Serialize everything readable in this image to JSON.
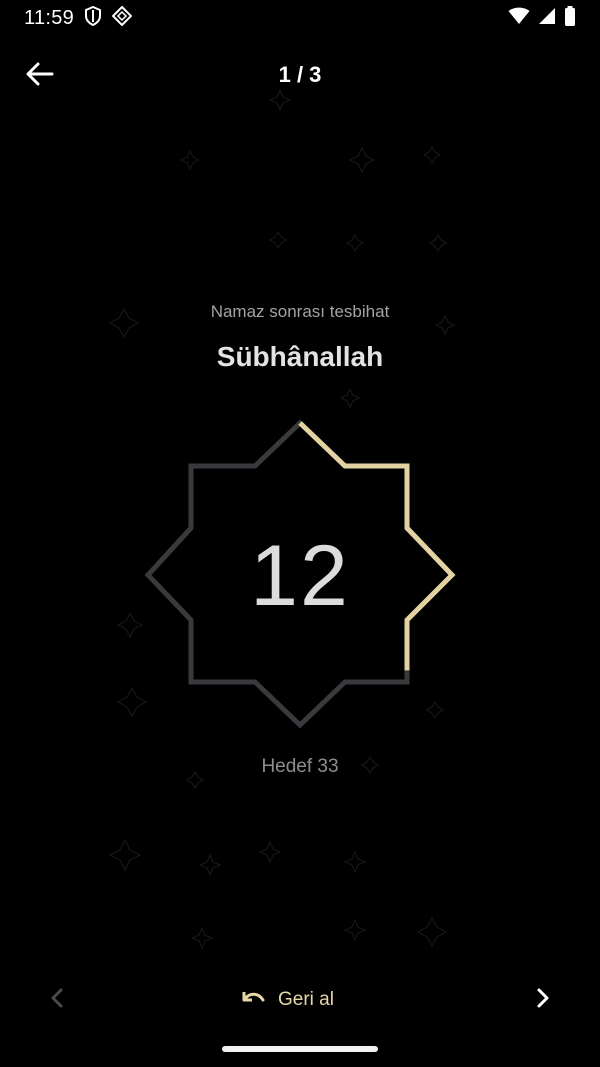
{
  "status_bar": {
    "time": "11:59",
    "left_icons": [
      "shield-icon",
      "app-notification-icon"
    ],
    "right_icons": [
      "wifi-icon",
      "signal-icon",
      "battery-icon"
    ]
  },
  "header": {
    "back_icon": "arrow-left-icon",
    "page_indicator": "1 / 3"
  },
  "dhikr": {
    "subtitle": "Namaz sonrası tesbihat",
    "title": "Sübhânallah",
    "count": "12",
    "target_label": "Hedef 33",
    "target": 33,
    "progress": 0.364
  },
  "bottom": {
    "prev_icon": "chevron-left-icon",
    "undo_icon": "undo-icon",
    "undo_label": "Geri al",
    "next_icon": "chevron-right-icon"
  },
  "colors": {
    "background": "#000000",
    "accent_gold": "#e4d3a2",
    "star_track": "#3a3a3e",
    "text_primary": "#e3e3e3",
    "text_secondary": "#a3a3a3"
  }
}
